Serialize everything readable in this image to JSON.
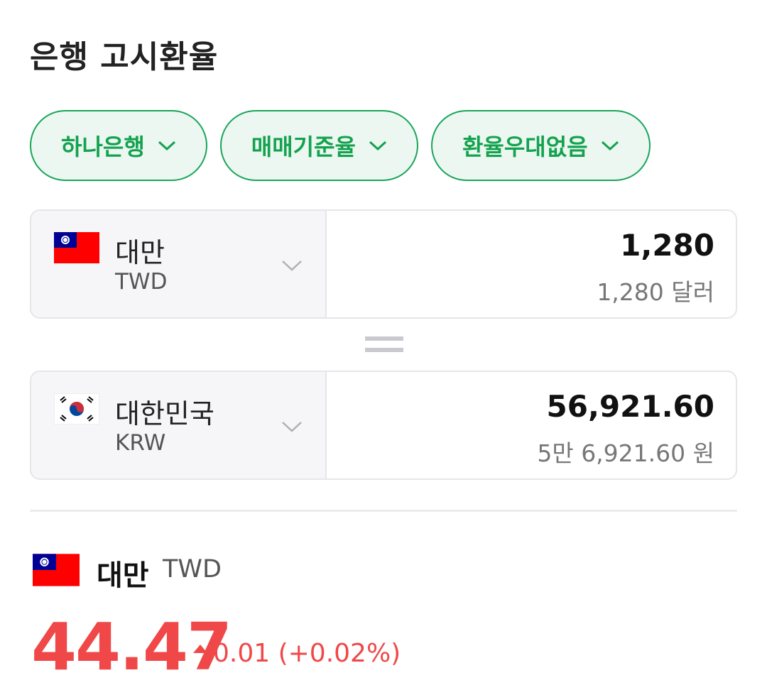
{
  "page": {
    "title": "은행 고시환율"
  },
  "filters": {
    "bank": "하나은행",
    "rate_type": "매매기준율",
    "preference": "환율우대없음",
    "chip_color": "#19a55b"
  },
  "converter": {
    "from": {
      "country": "대만",
      "code": "TWD",
      "flag_icon": "taiwan-flag-icon",
      "amount": "1,280",
      "amount_words": "1,280 달러"
    },
    "to": {
      "country": "대한민국",
      "code": "KRW",
      "flag_icon": "korea-flag-icon",
      "amount": "56,921.60",
      "amount_words": "5만 6,921.60 원"
    }
  },
  "detail": {
    "country": "대만",
    "code": "TWD",
    "rate": "44.47",
    "change": "0.01 (+0.02%)",
    "change_color": "#f04848"
  }
}
